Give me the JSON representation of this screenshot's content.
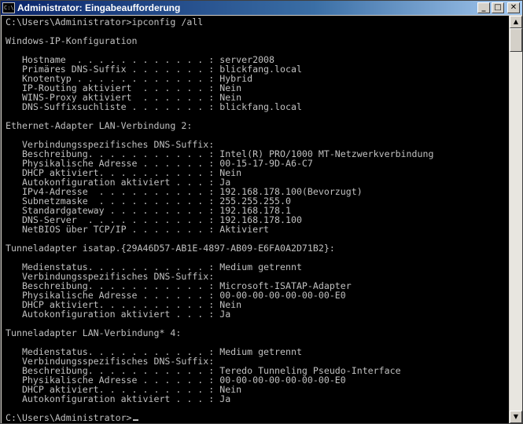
{
  "window": {
    "title": "Administrator: Eingabeaufforderung",
    "icon_text": "C:\\",
    "controls": {
      "minimize": "_",
      "maximize": "□",
      "close": "✕"
    }
  },
  "console": {
    "lines": [
      "C:\\Users\\Administrator>ipconfig /all",
      "",
      "Windows-IP-Konfiguration",
      "",
      "   Hostname  . . . . . . . . . . . . : server2008",
      "   Primäres DNS-Suffix . . . . . . . : blickfang.local",
      "   Knotentyp . . . . . . . . . . . . : Hybrid",
      "   IP-Routing aktiviert  . . . . . . : Nein",
      "   WINS-Proxy aktiviert  . . . . . . : Nein",
      "   DNS-Suffixsuchliste . . . . . . . : blickfang.local",
      "",
      "Ethernet-Adapter LAN-Verbindung 2:",
      "",
      "   Verbindungsspezifisches DNS-Suffix:",
      "   Beschreibung. . . . . . . . . . . : Intel(R) PRO/1000 MT-Netzwerkverbindung",
      "   Physikalische Adresse . . . . . . : 00-15-17-9D-A6-C7",
      "   DHCP aktiviert. . . . . . . . . . : Nein",
      "   Autokonfiguration aktiviert . . . : Ja",
      "   IPv4-Adresse  . . . . . . . . . . : 192.168.178.100(Bevorzugt)",
      "   Subnetzmaske  . . . . . . . . . . : 255.255.255.0",
      "   Standardgateway . . . . . . . . . : 192.168.178.1",
      "   DNS-Server  . . . . . . . . . . . : 192.168.178.100",
      "   NetBIOS über TCP/IP . . . . . . . : Aktiviert",
      "",
      "Tunneladapter isatap.{29A46D57-AB1E-4897-AB09-E6FA0A2D71B2}:",
      "",
      "   Medienstatus. . . . . . . . . . . : Medium getrennt",
      "   Verbindungsspezifisches DNS-Suffix:",
      "   Beschreibung. . . . . . . . . . . : Microsoft-ISATAP-Adapter",
      "   Physikalische Adresse . . . . . . : 00-00-00-00-00-00-00-E0",
      "   DHCP aktiviert. . . . . . . . . . : Nein",
      "   Autokonfiguration aktiviert . . . : Ja",
      "",
      "Tunneladapter LAN-Verbindung* 4:",
      "",
      "   Medienstatus. . . . . . . . . . . : Medium getrennt",
      "   Verbindungsspezifisches DNS-Suffix:",
      "   Beschreibung. . . . . . . . . . . : Teredo Tunneling Pseudo-Interface",
      "   Physikalische Adresse . . . . . . : 00-00-00-00-00-00-00-E0",
      "   DHCP aktiviert. . . . . . . . . . : Nein",
      "   Autokonfiguration aktiviert . . . : Ja",
      "",
      "C:\\Users\\Administrator>"
    ]
  },
  "scrollbar": {
    "up_arrow": "▲",
    "down_arrow": "▼"
  },
  "colors": {
    "console_bg": "#000000",
    "console_fg": "#c0c0c0",
    "titlebar": "#0a246a"
  }
}
